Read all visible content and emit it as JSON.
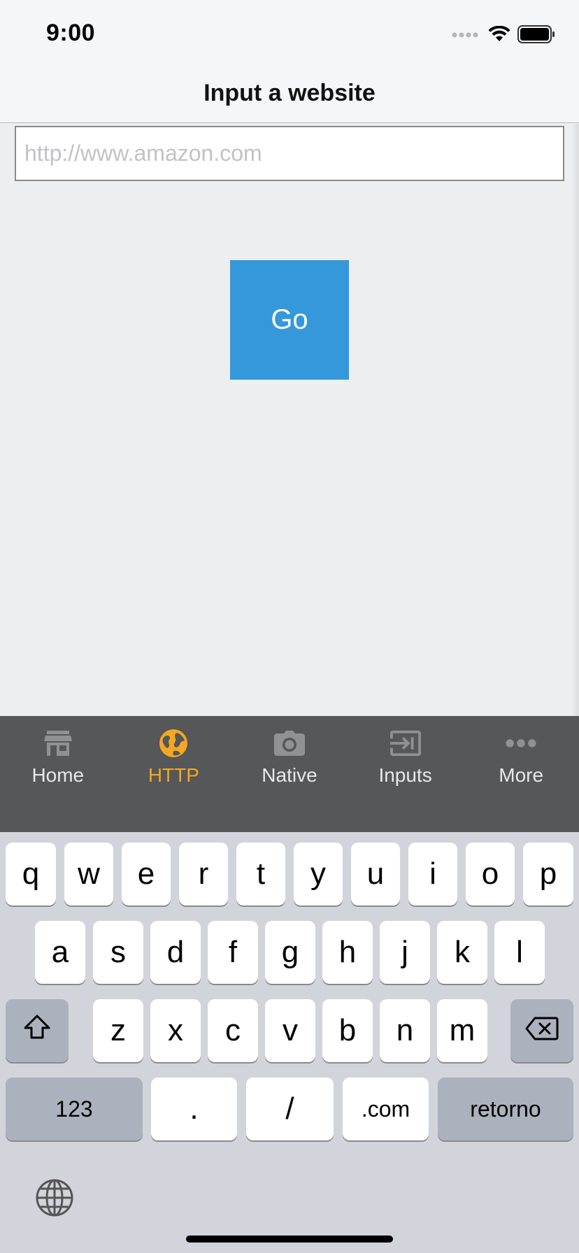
{
  "status_bar": {
    "time": "9:00"
  },
  "nav": {
    "title": "Input a website"
  },
  "form": {
    "url_placeholder": "http://www.amazon.com",
    "url_value": "",
    "go_label": "Go"
  },
  "tabs": [
    {
      "label": "Home",
      "icon": "store-icon",
      "active": false
    },
    {
      "label": "HTTP",
      "icon": "globe-icon",
      "active": true
    },
    {
      "label": "Native",
      "icon": "camera-icon",
      "active": false
    },
    {
      "label": "Inputs",
      "icon": "input-icon",
      "active": false
    },
    {
      "label": "More",
      "icon": "more-icon",
      "active": false
    }
  ],
  "keyboard": {
    "row1": [
      "q",
      "w",
      "e",
      "r",
      "t",
      "y",
      "u",
      "i",
      "o",
      "p"
    ],
    "row2": [
      "a",
      "s",
      "d",
      "f",
      "g",
      "h",
      "j",
      "k",
      "l"
    ],
    "row3": [
      "z",
      "x",
      "c",
      "v",
      "b",
      "n",
      "m"
    ],
    "row4": {
      "numbers": "123",
      "dot": ".",
      "slash": "/",
      "dotcom": ".com",
      "return": "retorno"
    }
  },
  "colors": {
    "accent": "#f5a623",
    "button": "#3498db",
    "tabbar": "#555759"
  }
}
